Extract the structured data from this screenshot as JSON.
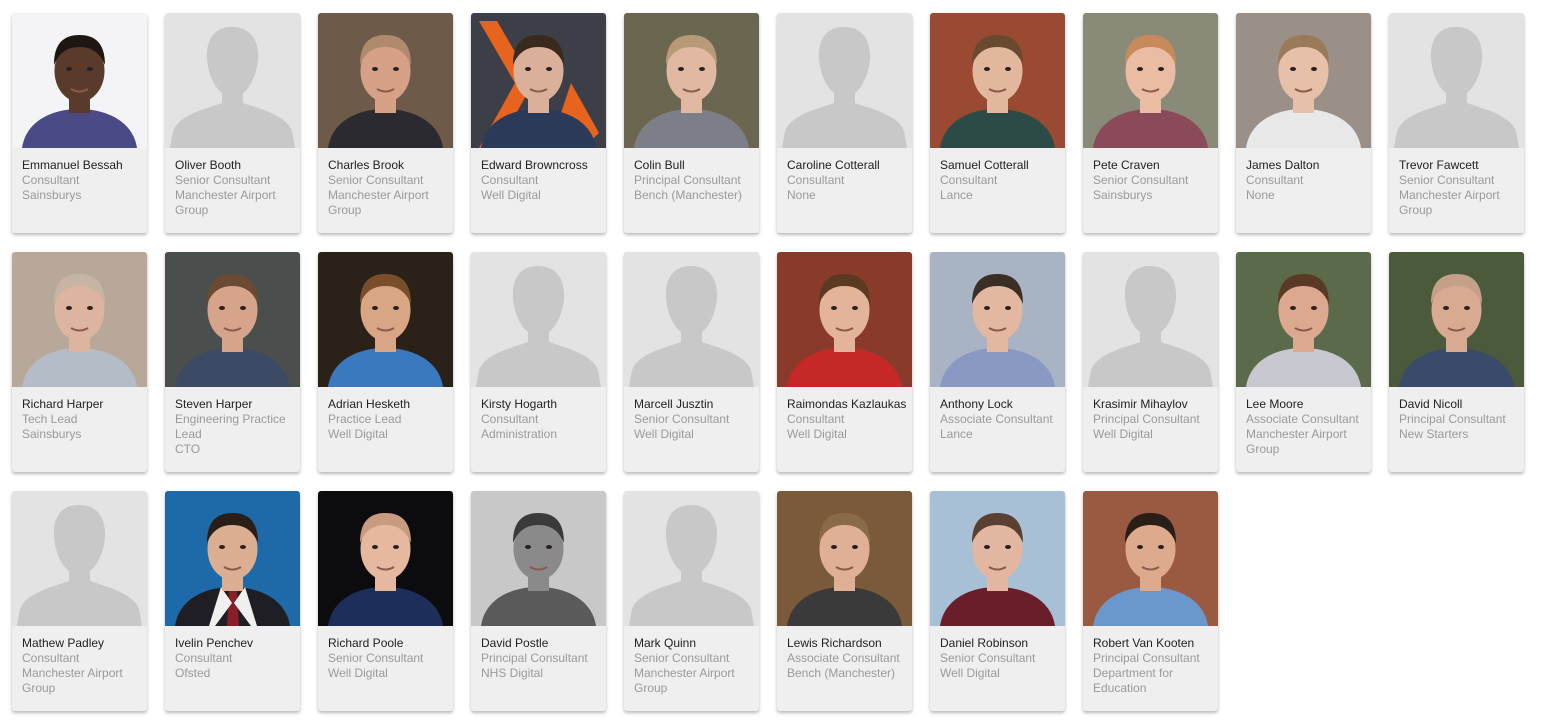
{
  "people": [
    {
      "name": "Emmanuel Bessah",
      "role": "Consultant",
      "client": "Sainsburys",
      "photo": {
        "kind": "photo",
        "bg": "#f4f4f6",
        "skin": "#5a3a2a",
        "hair": "#1e1612",
        "shirt": "#4a4a86"
      }
    },
    {
      "name": "Oliver Booth",
      "role": "Senior Consultant",
      "client": "Manchester Airport Group",
      "photo": {
        "kind": "placeholder"
      }
    },
    {
      "name": "Charles Brook",
      "role": "Senior Consultant",
      "client": "Manchester Airport Group",
      "photo": {
        "kind": "photo",
        "bg": "#6e5a48",
        "skin": "#d7a187",
        "hair": "#b08a6e",
        "shirt": "#2a2a30"
      }
    },
    {
      "name": "Edward Browncross",
      "role": "Consultant",
      "client": "Well Digital",
      "photo": {
        "kind": "photo",
        "bg": "#3c3f48",
        "skin": "#dbb09a",
        "hair": "#3a2a1e",
        "shirt": "#2c3a5a",
        "accent": "#e8641e"
      }
    },
    {
      "name": "Colin Bull",
      "role": "Principal Consultant",
      "client": "Bench (Manchester)",
      "photo": {
        "kind": "photo",
        "bg": "#6a6650",
        "skin": "#e1b8a2",
        "hair": "#b89a78",
        "shirt": "#7d7f88"
      }
    },
    {
      "name": "Caroline Cotterall",
      "role": "Consultant",
      "client": "None",
      "photo": {
        "kind": "placeholder"
      }
    },
    {
      "name": "Samuel Cotterall",
      "role": "Consultant",
      "client": "Lance",
      "photo": {
        "kind": "photo",
        "bg": "#9a4a32",
        "skin": "#e3b79e",
        "hair": "#6a4a2e",
        "shirt": "#2c4a46"
      }
    },
    {
      "name": "Pete Craven",
      "role": "Senior Consultant",
      "client": "Sainsburys",
      "photo": {
        "kind": "photo",
        "bg": "#8a8a78",
        "skin": "#eabca4",
        "hair": "#c88a5a",
        "shirt": "#8a4a5a"
      }
    },
    {
      "name": "James Dalton",
      "role": "Consultant",
      "client": "None",
      "photo": {
        "kind": "photo",
        "bg": "#9a9088",
        "skin": "#e6c0a8",
        "hair": "#9a7a58",
        "shirt": "#e8e8e8"
      }
    },
    {
      "name": "Trevor Fawcett",
      "role": "Senior Consultant",
      "client": "Manchester Airport Group",
      "photo": {
        "kind": "placeholder"
      }
    },
    {
      "name": "Richard Harper",
      "role": "Tech Lead",
      "client": "Sainsburys",
      "photo": {
        "kind": "photo",
        "bg": "#b8a89a",
        "skin": "#dcb4a0",
        "hair": "#c8b4a4",
        "shirt": "#b4bcc8"
      }
    },
    {
      "name": "Steven Harper",
      "role": "Engineering Practice Lead",
      "client": "CTO",
      "photo": {
        "kind": "photo",
        "bg": "#4a4e4c",
        "skin": "#d6a48a",
        "hair": "#6a4a32",
        "shirt": "#3c4a66"
      }
    },
    {
      "name": "Adrian Hesketh",
      "role": "Practice Lead",
      "client": "Well Digital",
      "photo": {
        "kind": "photo",
        "bg": "#2a2218",
        "skin": "#d8a684",
        "hair": "#7a4e2a",
        "shirt": "#3a78c0"
      }
    },
    {
      "name": "Kirsty Hogarth",
      "role": "Consultant",
      "client": "Administration",
      "photo": {
        "kind": "placeholder"
      }
    },
    {
      "name": "Marcell Jusztin",
      "role": "Senior Consultant",
      "client": "Well Digital",
      "photo": {
        "kind": "placeholder"
      }
    },
    {
      "name": "Raimondas Kazlaukas",
      "role": "Consultant",
      "client": "Well Digital",
      "photo": {
        "kind": "photo",
        "bg": "#8a3a2a",
        "skin": "#e4b49a",
        "hair": "#5a3a22",
        "shirt": "#c62828"
      }
    },
    {
      "name": "Anthony Lock",
      "role": "Associate Consultant",
      "client": "Lance",
      "photo": {
        "kind": "photo",
        "bg": "#a8b4c4",
        "skin": "#e4b8a0",
        "hair": "#3a2e26",
        "shirt": "#8a98c4"
      }
    },
    {
      "name": "Krasimir Mihaylov",
      "role": "Principal Consultant",
      "client": "Well Digital",
      "photo": {
        "kind": "placeholder"
      }
    },
    {
      "name": "Lee Moore",
      "role": "Associate Consultant",
      "client": "Manchester Airport Group",
      "photo": {
        "kind": "photo",
        "bg": "#5a6a4a",
        "skin": "#dca890",
        "hair": "#5a3a26",
        "shirt": "#c8c8d0"
      }
    },
    {
      "name": "David Nicoll",
      "role": "Principal Consultant",
      "client": "New Starters",
      "photo": {
        "kind": "photo",
        "bg": "#4a5a3a",
        "skin": "#d8aa92",
        "hair": "#c4a08a",
        "shirt": "#3a4a6a"
      }
    },
    {
      "name": "Mathew Padley",
      "role": "Consultant",
      "client": "Manchester Airport Group",
      "photo": {
        "kind": "placeholder"
      }
    },
    {
      "name": "Ivelin Penchev",
      "role": "Consultant",
      "client": "Ofsted",
      "photo": {
        "kind": "photo",
        "bg": "#1e6aa8",
        "skin": "#dcae92",
        "hair": "#2a1e18",
        "shirt": "#1e1e24",
        "tie": "#8a1e28"
      }
    },
    {
      "name": "Richard Poole",
      "role": "Senior Consultant",
      "client": "Well Digital",
      "photo": {
        "kind": "photo",
        "bg": "#0c0c0e",
        "skin": "#e6b8a0",
        "hair": "#c89a80",
        "shirt": "#1e2e5a"
      }
    },
    {
      "name": "David Postle",
      "role": "Principal Consultant",
      "client": "NHS Digital",
      "photo": {
        "kind": "photo",
        "bg": "#c8c8c8",
        "skin": "#8a8a8a",
        "hair": "#3a3a3a",
        "shirt": "#5a5a5a"
      }
    },
    {
      "name": "Mark Quinn",
      "role": "Senior Consultant",
      "client": "Manchester Airport Group",
      "photo": {
        "kind": "placeholder"
      }
    },
    {
      "name": "Lewis Richardson",
      "role": "Associate Consultant",
      "client": "Bench (Manchester)",
      "photo": {
        "kind": "photo",
        "bg": "#7a5a3a",
        "skin": "#e0b096",
        "hair": "#8a6a48",
        "shirt": "#3a3a3a"
      }
    },
    {
      "name": "Daniel Robinson",
      "role": "Senior Consultant",
      "client": "Well Digital",
      "photo": {
        "kind": "photo",
        "bg": "#a8c0d6",
        "skin": "#e2b6a0",
        "hair": "#5a4030",
        "shirt": "#6a1e2a"
      }
    },
    {
      "name": "Robert Van Kooten",
      "role": "Principal Consultant",
      "client": "Department for Education",
      "photo": {
        "kind": "photo",
        "bg": "#9a5a42",
        "skin": "#deaa8e",
        "hair": "#2a1e18",
        "shirt": "#6a98cc"
      }
    }
  ],
  "placeholder_colors": {
    "bg": "#e3e3e3",
    "silhouette": "#c8c8c8"
  }
}
